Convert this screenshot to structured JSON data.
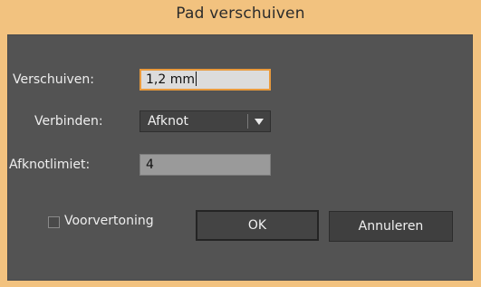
{
  "window": {
    "title": "Pad verschuiven"
  },
  "form": {
    "offset": {
      "label": "Verschuiven:",
      "value": "1,2 mm"
    },
    "joins": {
      "label": "Verbinden:",
      "selected": "Afknot"
    },
    "miter_limit": {
      "label": "Afknotlimiet:",
      "value": "4"
    },
    "preview": {
      "label": "Voorvertoning",
      "checked": false
    }
  },
  "buttons": {
    "ok": "OK",
    "cancel": "Annuleren"
  },
  "colors": {
    "title_bar": "#f2c27f",
    "panel": "#535353",
    "focus_border": "#e99a3d"
  }
}
